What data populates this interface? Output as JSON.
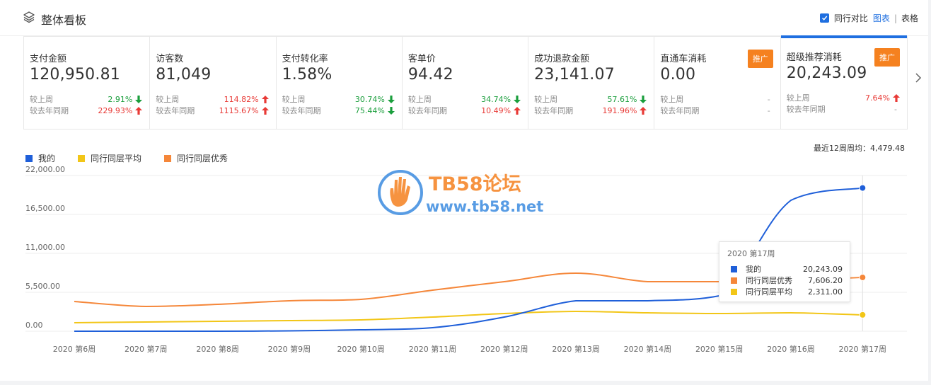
{
  "header": {
    "title": "整体看板",
    "compare_label": "同行对比",
    "view_chart": "图表",
    "separator": "|",
    "view_table": "表格"
  },
  "cards": [
    {
      "label": "支付金额",
      "value": "120,950.81",
      "wow_label": "较上周",
      "wow_value": "2.91%",
      "wow_trend": "down-green",
      "yoy_label": "较去年同期",
      "yoy_value": "229.93%",
      "yoy_trend": "up-red"
    },
    {
      "label": "访客数",
      "value": "81,049",
      "wow_label": "较上周",
      "wow_value": "114.82%",
      "wow_trend": "up-red",
      "yoy_label": "较去年同期",
      "yoy_value": "1115.67%",
      "yoy_trend": "up-red"
    },
    {
      "label": "支付转化率",
      "value": "1.58%",
      "wow_label": "较上周",
      "wow_value": "30.74%",
      "wow_trend": "down-green",
      "yoy_label": "较去年同期",
      "yoy_value": "75.44%",
      "yoy_trend": "down-green"
    },
    {
      "label": "客单价",
      "value": "94.42",
      "wow_label": "较上周",
      "wow_value": "34.74%",
      "wow_trend": "down-green",
      "yoy_label": "较去年同期",
      "yoy_value": "10.49%",
      "yoy_trend": "up-red"
    },
    {
      "label": "成功退款金额",
      "value": "23,141.07",
      "wow_label": "较上周",
      "wow_value": "57.61%",
      "wow_trend": "down-green",
      "yoy_label": "较去年同期",
      "yoy_value": "191.96%",
      "yoy_trend": "up-red"
    },
    {
      "label": "直通车消耗",
      "value": "0.00",
      "badge": "推广",
      "wow_label": "较上周",
      "wow_value": "-",
      "wow_trend": "none",
      "yoy_label": "较去年同期",
      "yoy_value": "-",
      "yoy_trend": "none"
    },
    {
      "label": "超级推荐消耗",
      "value": "20,243.09",
      "badge": "推广",
      "wow_label": "较上周",
      "wow_value": "7.64%",
      "wow_trend": "up-red",
      "yoy_label": "较去年同期",
      "yoy_value": "-",
      "yoy_trend": "none"
    }
  ],
  "weekly_avg": "最近12周周均：4,479.48",
  "watermark": {
    "title": "TB58论坛",
    "url": "www.tb58.net"
  },
  "tooltip": {
    "title": "2020 第17周",
    "rows": [
      {
        "name": "我的",
        "value": "20,243.09",
        "color": "#1f5fd9"
      },
      {
        "name": "同行同层优秀",
        "value": "7,606.20",
        "color": "#f5873a"
      },
      {
        "name": "同行同层平均",
        "value": "2,311.00",
        "color": "#f2c618"
      }
    ]
  },
  "colors": {
    "mine": "#1f5fd9",
    "avg": "#f2c618",
    "excellent": "#f5873a",
    "accent": "#1f6fe0",
    "badge": "#f5811f"
  },
  "chart_data": {
    "type": "line",
    "categories": [
      "2020 第6周",
      "2020 第7周",
      "2020 第8周",
      "2020 第9周",
      "2020 第10周",
      "2020 第11周",
      "2020 第12周",
      "2020 第13周",
      "2020 第14周",
      "2020 第15周",
      "2020 第16周",
      "2020 第17周"
    ],
    "series": [
      {
        "name": "我的",
        "color": "#1f5fd9",
        "values": [
          0,
          0,
          0,
          50,
          200,
          500,
          2000,
          4300,
          4300,
          5000,
          18500,
          20243.09
        ]
      },
      {
        "name": "同行同层平均",
        "color": "#f2c618",
        "values": [
          1200,
          1300,
          1400,
          1500,
          1600,
          2000,
          2500,
          2800,
          2600,
          2500,
          2600,
          2311.0
        ]
      },
      {
        "name": "同行同层优秀",
        "color": "#f5873a",
        "values": [
          4200,
          3500,
          3800,
          4300,
          4500,
          5800,
          7000,
          8200,
          7000,
          7000,
          7200,
          7606.2
        ]
      }
    ],
    "yticks": [
      "0.00",
      "5,500.00",
      "11,000.00",
      "16,500.00",
      "22,000.00"
    ],
    "ylim": [
      0,
      22000
    ],
    "grid": true,
    "legend": "top-left"
  }
}
